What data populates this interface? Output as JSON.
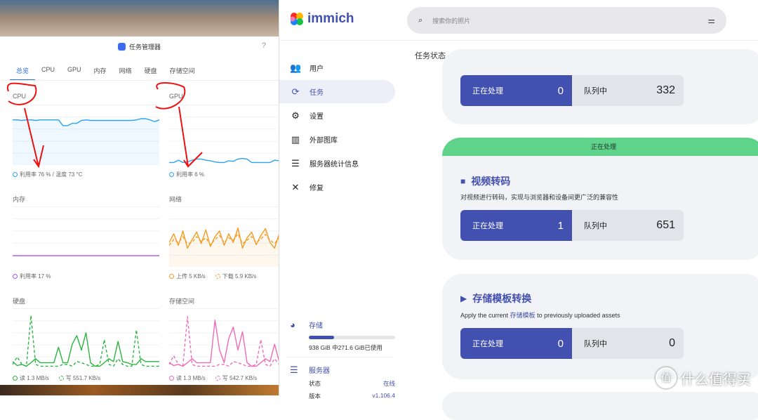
{
  "task_manager": {
    "title": "任务管理器",
    "help": "?",
    "tabs": [
      "总览",
      "CPU",
      "GPU",
      "内存",
      "网络",
      "硬盘",
      "存储空间"
    ],
    "charts": [
      {
        "label": "CPU",
        "color": "#2aa3f0",
        "legend": [
          {
            "text": "利用率 76 % / 温度 73 °C",
            "dashed": false
          }
        ],
        "fill": true,
        "series": [
          [
            76,
            76,
            75,
            76,
            76,
            75,
            76,
            76,
            76,
            76,
            76,
            66,
            66,
            70,
            70,
            75,
            76,
            75,
            75,
            75,
            75,
            75,
            75,
            75,
            75,
            75,
            75,
            76,
            78,
            78,
            76,
            73,
            76
          ]
        ]
      },
      {
        "label": "GPU",
        "color": "#2aa3f0",
        "legend": [
          {
            "text": "利用率 6 %",
            "dashed": false
          }
        ],
        "fill": false,
        "series": [
          [
            2,
            2,
            6,
            2,
            3,
            6,
            8,
            8,
            6,
            5,
            3,
            2,
            2,
            5,
            4,
            8,
            9,
            8,
            2,
            2,
            2,
            2,
            2,
            6,
            5,
            5,
            3,
            2,
            2,
            2,
            2,
            2,
            2
          ]
        ]
      },
      {
        "label": "内存",
        "color": "#a855f7",
        "legend": [
          {
            "text": "利用率 17 %",
            "dashed": false
          }
        ],
        "fill": false,
        "series": [
          [
            17,
            17,
            17,
            17,
            17,
            17,
            17,
            17,
            17,
            17,
            17,
            17,
            17,
            17,
            17,
            17,
            17,
            17,
            17,
            17,
            17,
            17,
            17,
            17,
            17,
            17,
            17,
            17,
            17,
            17,
            17,
            17,
            17
          ]
        ]
      },
      {
        "label": "网络",
        "color": "#f59a23",
        "legend": [
          {
            "text": "上传 5 KB/s",
            "dashed": false
          },
          {
            "text": "下载 5.9 KB/s",
            "dashed": true
          }
        ],
        "fill": true,
        "series": [
          [
            40,
            55,
            35,
            60,
            30,
            45,
            58,
            38,
            62,
            33,
            50,
            60,
            35,
            55,
            40,
            65,
            30,
            48,
            58,
            36,
            52,
            64,
            40,
            30,
            55,
            66,
            45,
            35,
            58,
            50,
            40,
            60,
            45
          ],
          [
            35,
            45,
            40,
            50,
            38,
            40,
            50,
            42,
            48,
            36,
            45,
            52,
            40,
            48,
            44,
            55,
            38,
            44,
            50,
            40,
            46,
            54,
            44,
            38,
            48,
            58,
            46,
            40,
            50,
            46,
            42,
            52,
            44
          ]
        ]
      },
      {
        "label": "硬盘",
        "color": "#2bb540",
        "legend": [
          {
            "text": "读 1.3 MB/s",
            "dashed": false
          },
          {
            "text": "写 551.7 KB/s",
            "dashed": true
          }
        ],
        "fill": false,
        "series": [
          [
            10,
            3,
            5,
            2,
            8,
            15,
            8,
            8,
            8,
            8,
            35,
            8,
            8,
            40,
            55,
            30,
            60,
            8,
            2,
            2,
            8,
            15,
            10,
            45,
            10,
            8,
            5,
            5,
            15,
            10,
            10,
            10,
            10
          ],
          [
            5,
            18,
            5,
            2,
            90,
            5,
            2,
            2,
            2,
            2,
            2,
            5,
            5,
            2,
            10,
            8,
            5,
            2,
            2,
            5,
            48,
            5,
            2,
            15,
            5,
            2,
            2,
            65,
            5,
            2,
            2,
            2,
            2
          ]
        ]
      },
      {
        "label": "存储空间",
        "color": "#f06ab8",
        "legend": [
          {
            "text": "读 1.3 MB/s",
            "dashed": false
          },
          {
            "text": "写 542.7 KB/s",
            "dashed": true
          }
        ],
        "fill": false,
        "series": [
          [
            8,
            3,
            5,
            2,
            8,
            15,
            8,
            8,
            8,
            8,
            82,
            30,
            8,
            50,
            70,
            30,
            62,
            8,
            2,
            2,
            8,
            15,
            10,
            40,
            10,
            8,
            5,
            5,
            15,
            10,
            10,
            10,
            10
          ],
          [
            5,
            20,
            5,
            2,
            88,
            5,
            2,
            2,
            2,
            2,
            2,
            5,
            5,
            2,
            10,
            8,
            5,
            2,
            2,
            5,
            48,
            5,
            2,
            15,
            5,
            2,
            2,
            22,
            5,
            2,
            2,
            2,
            2
          ]
        ]
      }
    ]
  },
  "immich": {
    "brand": "immich",
    "search_placeholder": "搜索你的照片",
    "nav": [
      {
        "label": "用户",
        "icon": "users-icon"
      },
      {
        "label": "任务",
        "icon": "sync-icon",
        "active": true
      },
      {
        "label": "设置",
        "icon": "gear-icon"
      },
      {
        "label": "外部图库",
        "icon": "library-icon"
      },
      {
        "label": "服务器统计信息",
        "icon": "server-icon"
      },
      {
        "label": "修复",
        "icon": "tools-icon"
      }
    ],
    "storage": {
      "title": "存储",
      "used_fraction": 0.29,
      "text": "938 GiB 中271.6 GiB已使用"
    },
    "server": {
      "title": "服务器",
      "status_label": "状态",
      "status_value": "在线",
      "version_label": "版本",
      "version_value": "v1.106.4"
    },
    "page_title": "任务状态",
    "jobs": [
      {
        "active": "正在处理",
        "active_count": "0",
        "queue": "队列中",
        "queue_count": "332"
      },
      {
        "header": "正在处理",
        "title": "视频转码",
        "desc": "对视频进行转码，实现与浏览器和设备间更广泛的兼容性",
        "active": "正在处理",
        "active_count": "1",
        "queue": "队列中",
        "queue_count": "651"
      },
      {
        "title": "存储模板转换",
        "desc_pre": "Apply the current ",
        "desc_link": "存储模板",
        "desc_post": " to previously uploaded assets",
        "active": "正在处理",
        "active_count": "0",
        "queue": "队列中",
        "queue_count": "0"
      }
    ]
  },
  "watermark": {
    "icon": "值",
    "text": "什么值得买"
  }
}
